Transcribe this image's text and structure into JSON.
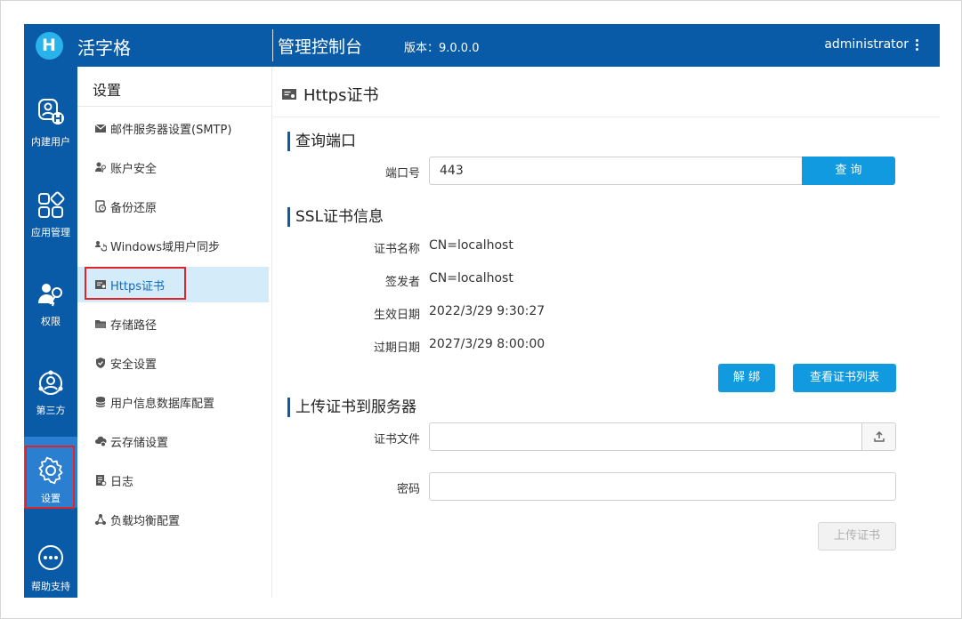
{
  "header": {
    "brand": "活字格",
    "console_title": "管理控制台",
    "version": "版本：9.0.0.0",
    "user": "administrator"
  },
  "rail": {
    "items": [
      {
        "label": "内建用户",
        "icon": "user-h-icon"
      },
      {
        "label": "应用管理",
        "icon": "apps-icon"
      },
      {
        "label": "权限",
        "icon": "permission-key-icon"
      },
      {
        "label": "第三方",
        "icon": "third-party-icon"
      },
      {
        "label": "设置",
        "icon": "gear-icon"
      },
      {
        "label": "帮助支持",
        "icon": "ellipsis-circle-icon"
      }
    ]
  },
  "menu": {
    "title": "设置",
    "items": [
      {
        "label": "邮件服务器设置(SMTP)",
        "icon": "mail-icon"
      },
      {
        "label": "账户安全",
        "icon": "user-key-icon"
      },
      {
        "label": "备份还原",
        "icon": "backup-icon"
      },
      {
        "label": "Windows域用户同步",
        "icon": "sync-users-icon"
      },
      {
        "label": "Https证书",
        "icon": "certificate-icon"
      },
      {
        "label": "存储路径",
        "icon": "folder-icon"
      },
      {
        "label": "安全设置",
        "icon": "shield-icon"
      },
      {
        "label": "用户信息数据库配置",
        "icon": "database-icon"
      },
      {
        "label": "云存储设置",
        "icon": "cloud-gear-icon"
      },
      {
        "label": "日志",
        "icon": "log-icon"
      },
      {
        "label": "负载均衡配置",
        "icon": "load-balance-icon"
      }
    ],
    "active_index": 4
  },
  "main": {
    "title": "Https证书",
    "query": {
      "section": "查询端口",
      "port_label": "端口号",
      "port_value": "443",
      "query_button": "查 询"
    },
    "ssl": {
      "section": "SSL证书信息",
      "name_label": "证书名称",
      "name_value": "CN=localhost",
      "issuer_label": "签发者",
      "issuer_value": "CN=localhost",
      "valid_from_label": "生效日期",
      "valid_from_value": "2022/3/29 9:30:27",
      "valid_to_label": "过期日期",
      "valid_to_value": "2027/3/29 8:00:00",
      "unbind_button": "解 绑",
      "list_button": "查看证书列表"
    },
    "upload": {
      "section": "上传证书到服务器",
      "file_label": "证书文件",
      "file_value": "",
      "password_label": "密码",
      "password_value": "",
      "upload_button": "上传证书"
    }
  },
  "colors": {
    "primary": "#0a5ba7",
    "accent": "#119ae0",
    "active_menu_bg": "#d4ecf9",
    "highlight_border": "#e2232a"
  }
}
